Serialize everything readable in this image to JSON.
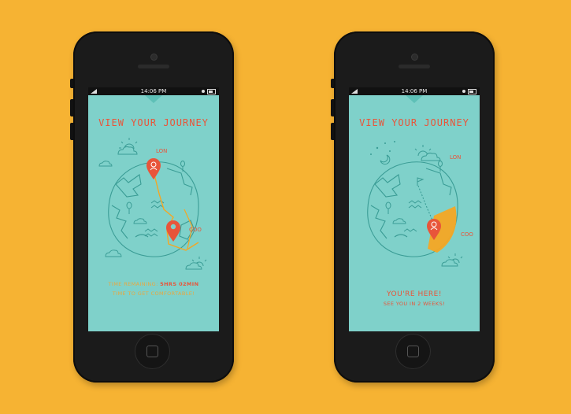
{
  "colors": {
    "background": "#f6b333",
    "screen": "#7fd1ca",
    "line": "#3a9c95",
    "accent": "#e8553a",
    "route": "#f5a623"
  },
  "screens": [
    {
      "status_time": "14:06 PM",
      "title": "VIEW YOUR JOURNEY",
      "origin_label": "LON",
      "destination_label": "COO",
      "time_remaining_label": "TIME REMAINING:",
      "time_remaining_value": "5HRS 02MIN",
      "message": "TIME TO GET COMFORTABLE!",
      "icons": [
        "map-pin-icon",
        "globe-icon",
        "cloud-icon",
        "sun-icon",
        "wave-icon",
        "tree-icon"
      ]
    },
    {
      "status_time": "14:06 PM",
      "title": "VIEW YOUR JOURNEY",
      "origin_label": "LON",
      "destination_label": "COO",
      "here_title": "YOU'RE HERE!",
      "here_subtitle": "SEE YOU IN 2 WEEKS!",
      "icons": [
        "map-pin-icon",
        "globe-icon",
        "cloud-icon",
        "sun-icon",
        "moon-icon",
        "flag-icon",
        "wave-icon",
        "tree-icon"
      ]
    }
  ]
}
